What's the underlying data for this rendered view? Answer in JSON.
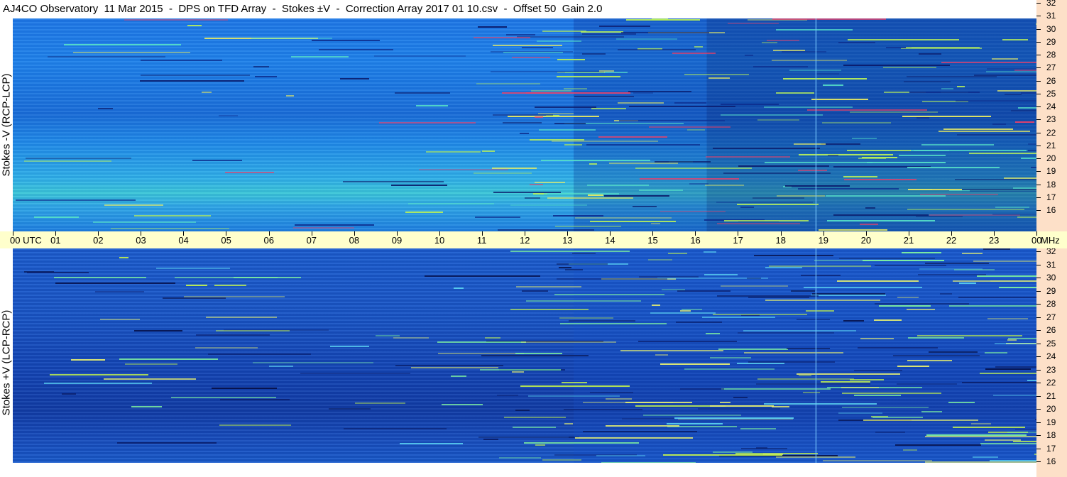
{
  "title": "AJ4CO Observatory  11 Mar 2015  -  DPS on TFD Array  -  Stokes ±V  -  Correction Array 2017 01 10.csv  -  Offset 50  Gain 2.0",
  "panels": {
    "top": {
      "label": "Stokes -V (RCP-LCP)"
    },
    "bottom": {
      "label": "Stokes +V (LCP-RCP)"
    }
  },
  "freq_axis": {
    "unit": "MHz",
    "ticks": [
      "32",
      "31",
      "30",
      "29",
      "28",
      "27",
      "26",
      "25",
      "24",
      "23",
      "22",
      "21",
      "20",
      "19",
      "18",
      "17",
      "16"
    ]
  },
  "time_axis": {
    "ticks": [
      "00  UTC",
      "01",
      "02",
      "03",
      "04",
      "05",
      "06",
      "07",
      "08",
      "09",
      "10",
      "11",
      "12",
      "13",
      "14",
      "15",
      "16",
      "17",
      "18",
      "19",
      "20",
      "21",
      "22",
      "23",
      "00"
    ],
    "unit_label": "MHz"
  },
  "colors": {
    "background": "#ffffff",
    "freq_axis_bg": "#fde0c8",
    "time_axis_bg": "#ffffcc",
    "spectrogram_top": "#1e82ea",
    "spectrogram_bottom": "#1a58c8"
  }
}
